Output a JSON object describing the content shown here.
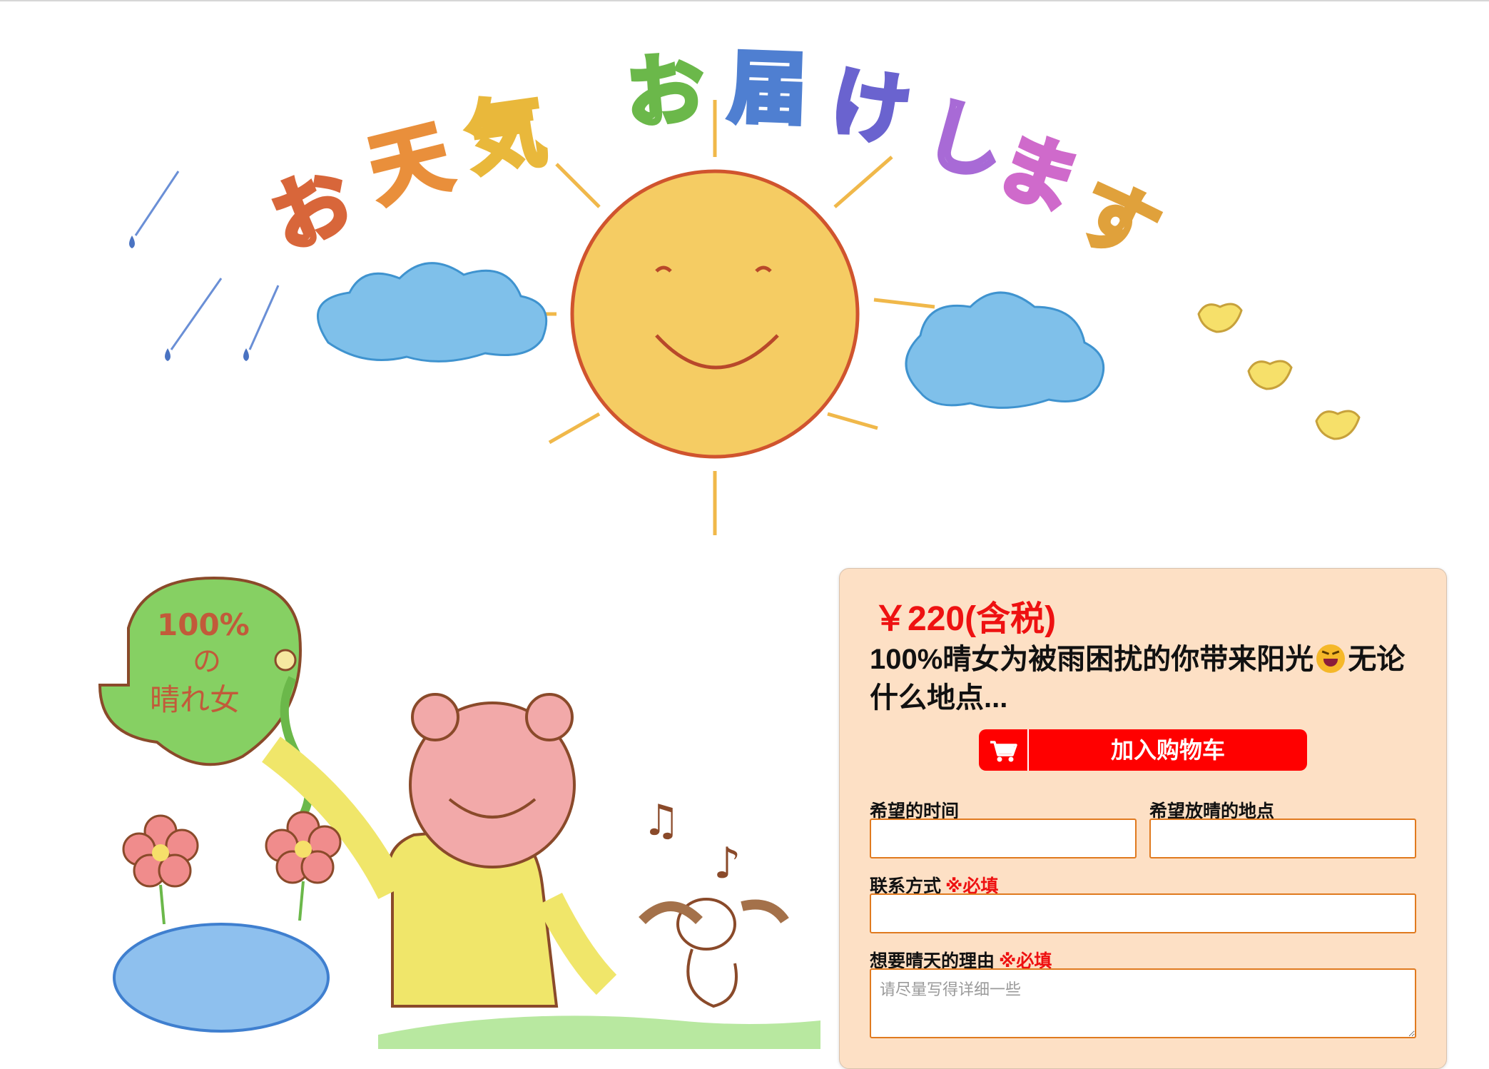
{
  "hero": {
    "title_text": "お天気 お届けします"
  },
  "illustration": {
    "leaf_text_line1": "100%",
    "leaf_text_line2": "の",
    "leaf_text_line3": "晴れ女"
  },
  "product": {
    "price": "￥220(含税)",
    "title_part1": "100%晴女为被雨困扰的你带来阳光",
    "title_emoji": "laughing-face-icon",
    "title_part2": "无论什么地点...",
    "add_to_cart_label": "加入购物车",
    "cart_icon": "shopping-cart-icon",
    "accent_color": "#ff0000",
    "panel_color": "#fde0c5"
  },
  "form": {
    "time_label": "希望的时间",
    "place_label": "希望放晴的地点",
    "contact_label": "联系方式",
    "reason_label": "想要晴天的理由",
    "required_mark": "※必填",
    "reason_placeholder": "请尽量写得详细一些",
    "time_value": "",
    "place_value": "",
    "contact_value": "",
    "reason_value": ""
  }
}
